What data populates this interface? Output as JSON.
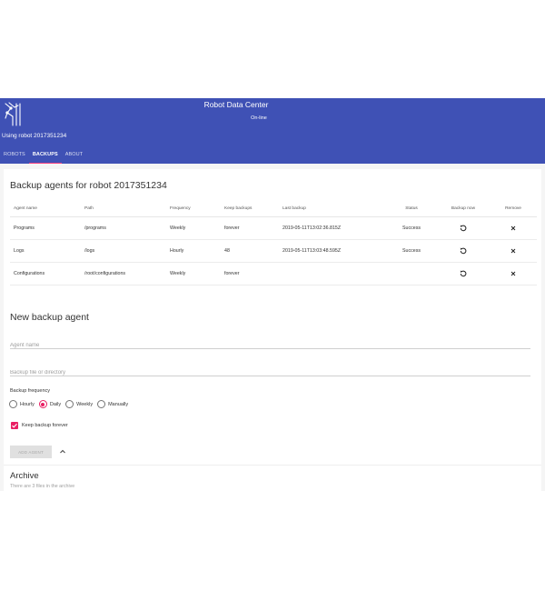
{
  "header": {
    "title": "Robot Data Center",
    "status": "On-line",
    "robot_caption": "Using robot 2017351234",
    "logo_icon": "robot-arm-logo-icon",
    "tabs": [
      {
        "label": "ROBOTS",
        "active": false
      },
      {
        "label": "BACKUPS",
        "active": true
      },
      {
        "label": "ABOUT",
        "active": false
      }
    ]
  },
  "agents": {
    "title": "Backup agents for robot 2017351234",
    "columns": [
      "Agent name",
      "Path",
      "Frequency",
      "Keep backups",
      "Last backup",
      "Status",
      "Backup now",
      "Remove"
    ],
    "rows": [
      {
        "name": "Programs",
        "path": "/programs",
        "frequency": "Weekly",
        "keep": "forever",
        "last_backup": "2019-05-11T13:02:36.815Z",
        "status": "Success"
      },
      {
        "name": "Logs",
        "path": "/logs",
        "frequency": "Hourly",
        "keep": "48",
        "last_backup": "2019-05-11T13:03:48.595Z",
        "status": "Success"
      },
      {
        "name": "Configurations",
        "path": "/root/configurations",
        "frequency": "Weekly",
        "keep": "forever",
        "last_backup": "",
        "status": ""
      }
    ],
    "backup_now_icon": "refresh-icon",
    "remove_icon": "close-icon"
  },
  "new_agent": {
    "title": "New backup agent",
    "name_placeholder": "Agent name",
    "path_placeholder": "Backup file or directory",
    "frequency_label": "Backup frequency",
    "frequency_options": [
      "Hourly",
      "Daily",
      "Weekly",
      "Manually"
    ],
    "frequency_selected": "Daily",
    "keep_forever_label": "Keep backup forever",
    "keep_forever_checked": true,
    "add_button_label": "ADD AGENT",
    "collapse_icon": "chevron-up-icon"
  },
  "archive": {
    "title": "Archive",
    "subtitle": "There are 3 files in the archive"
  },
  "colors": {
    "header": "#3f51b5",
    "accent": "#e91e63"
  }
}
